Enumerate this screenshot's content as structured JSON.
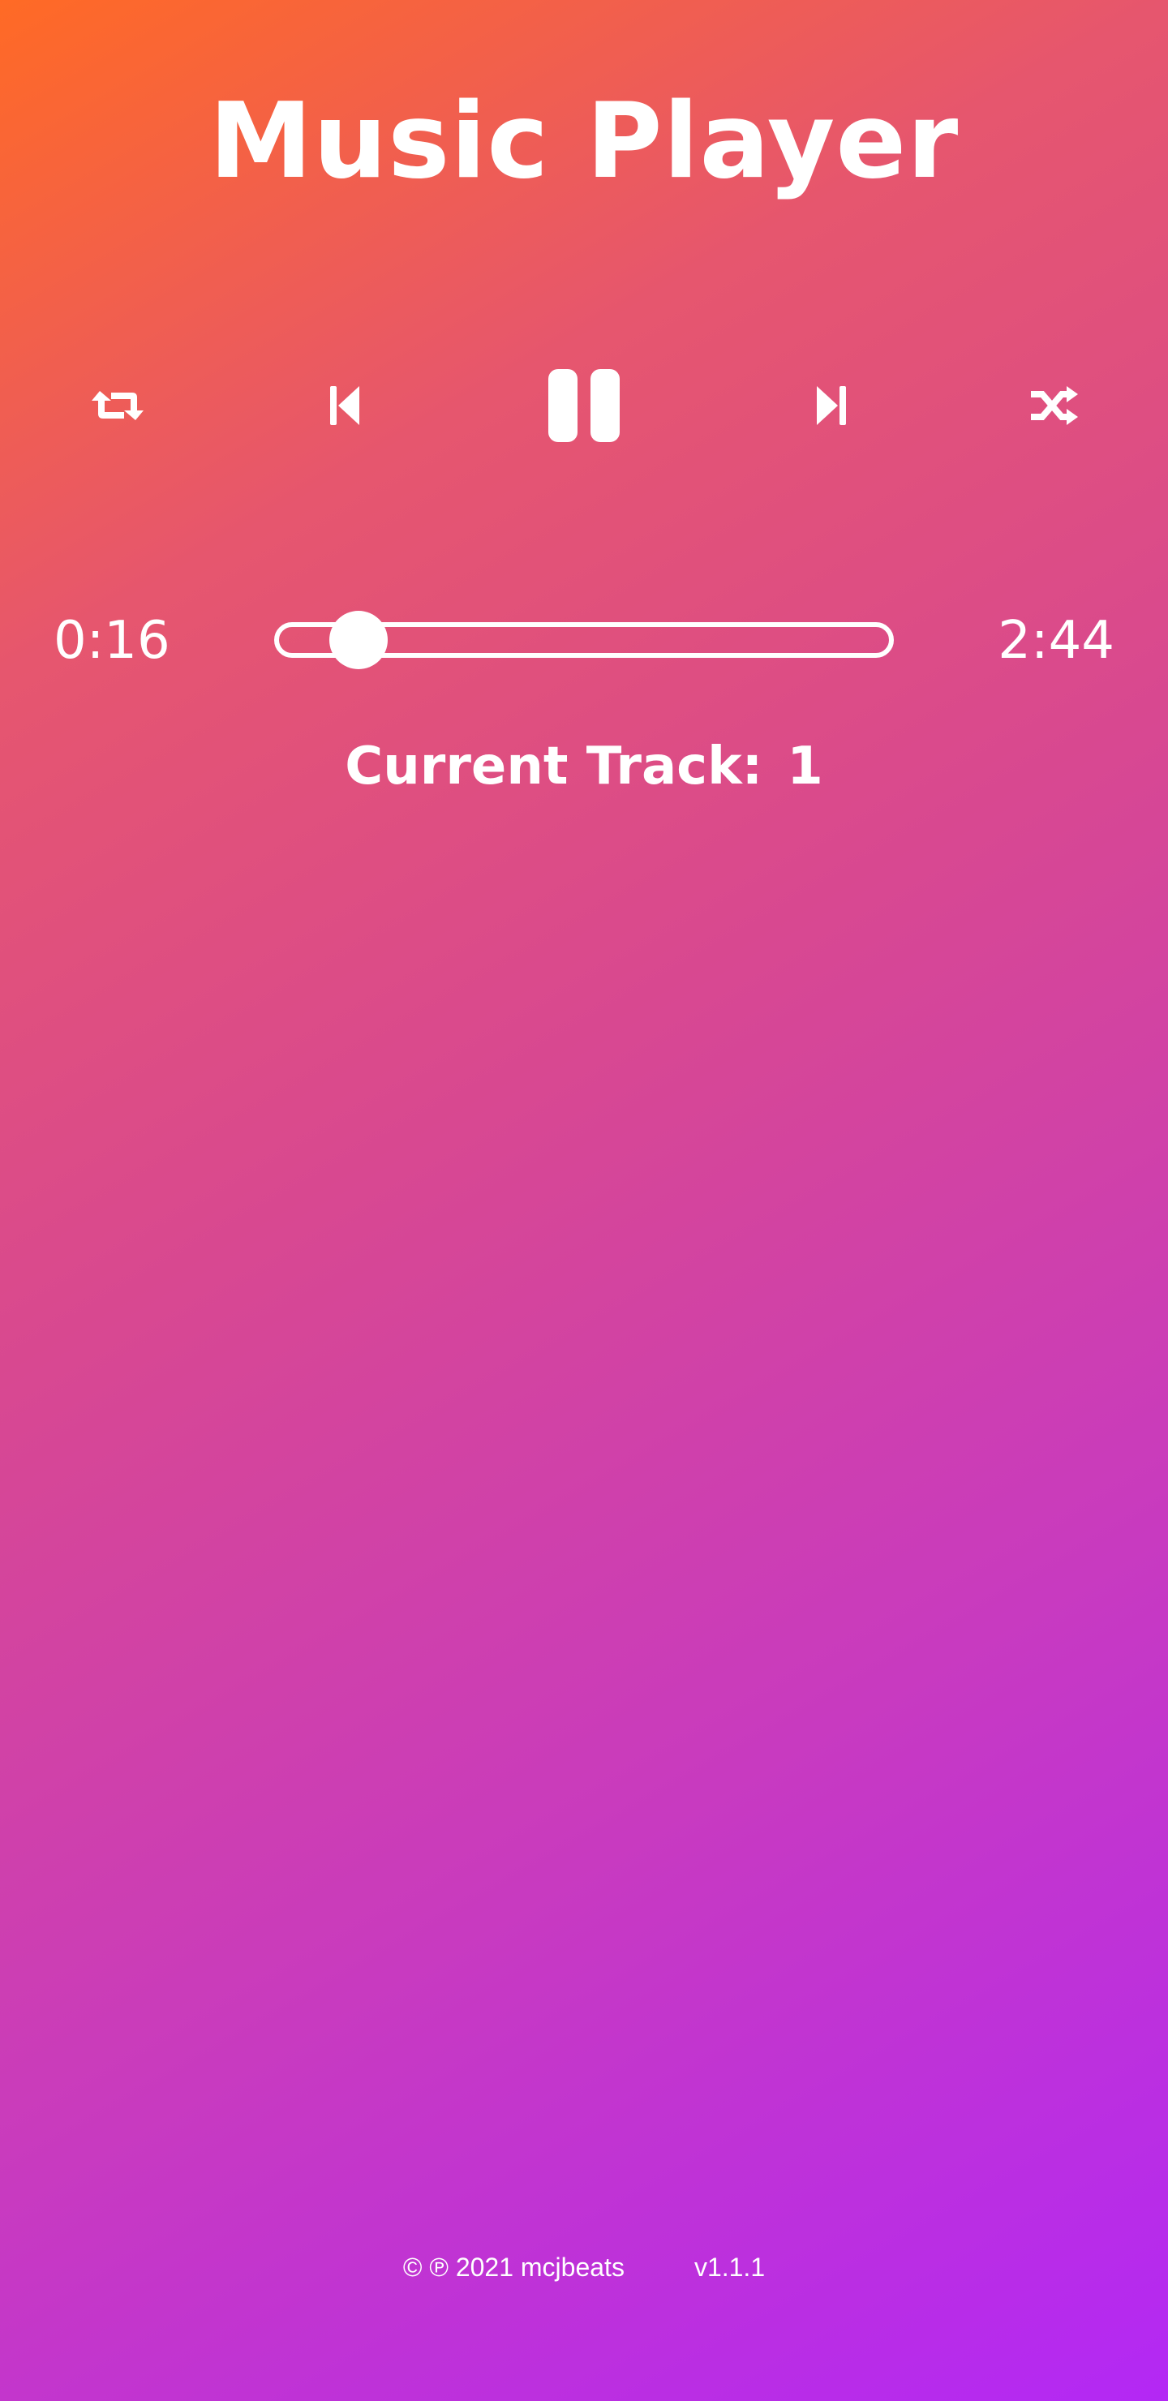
{
  "app": {
    "title": "Music Player"
  },
  "controls": {
    "repeat": {
      "icon": "repeat-icon"
    },
    "previous": {
      "icon": "skip-previous-icon"
    },
    "play_pause": {
      "icon": "pause-icon",
      "state": "playing"
    },
    "next": {
      "icon": "skip-next-icon"
    },
    "shuffle": {
      "icon": "shuffle-icon"
    }
  },
  "progress": {
    "current_time": "0:16",
    "total_time": "2:44",
    "fraction": 0.0976
  },
  "track": {
    "label": "Current Track:",
    "number": "1"
  },
  "footer": {
    "copyright": "© ℗ 2021 mcjbeats",
    "version": "v1.1.1"
  },
  "colors": {
    "gradient_start": "#ff6a25",
    "gradient_end": "#b328f5",
    "foreground": "#ffffff"
  }
}
